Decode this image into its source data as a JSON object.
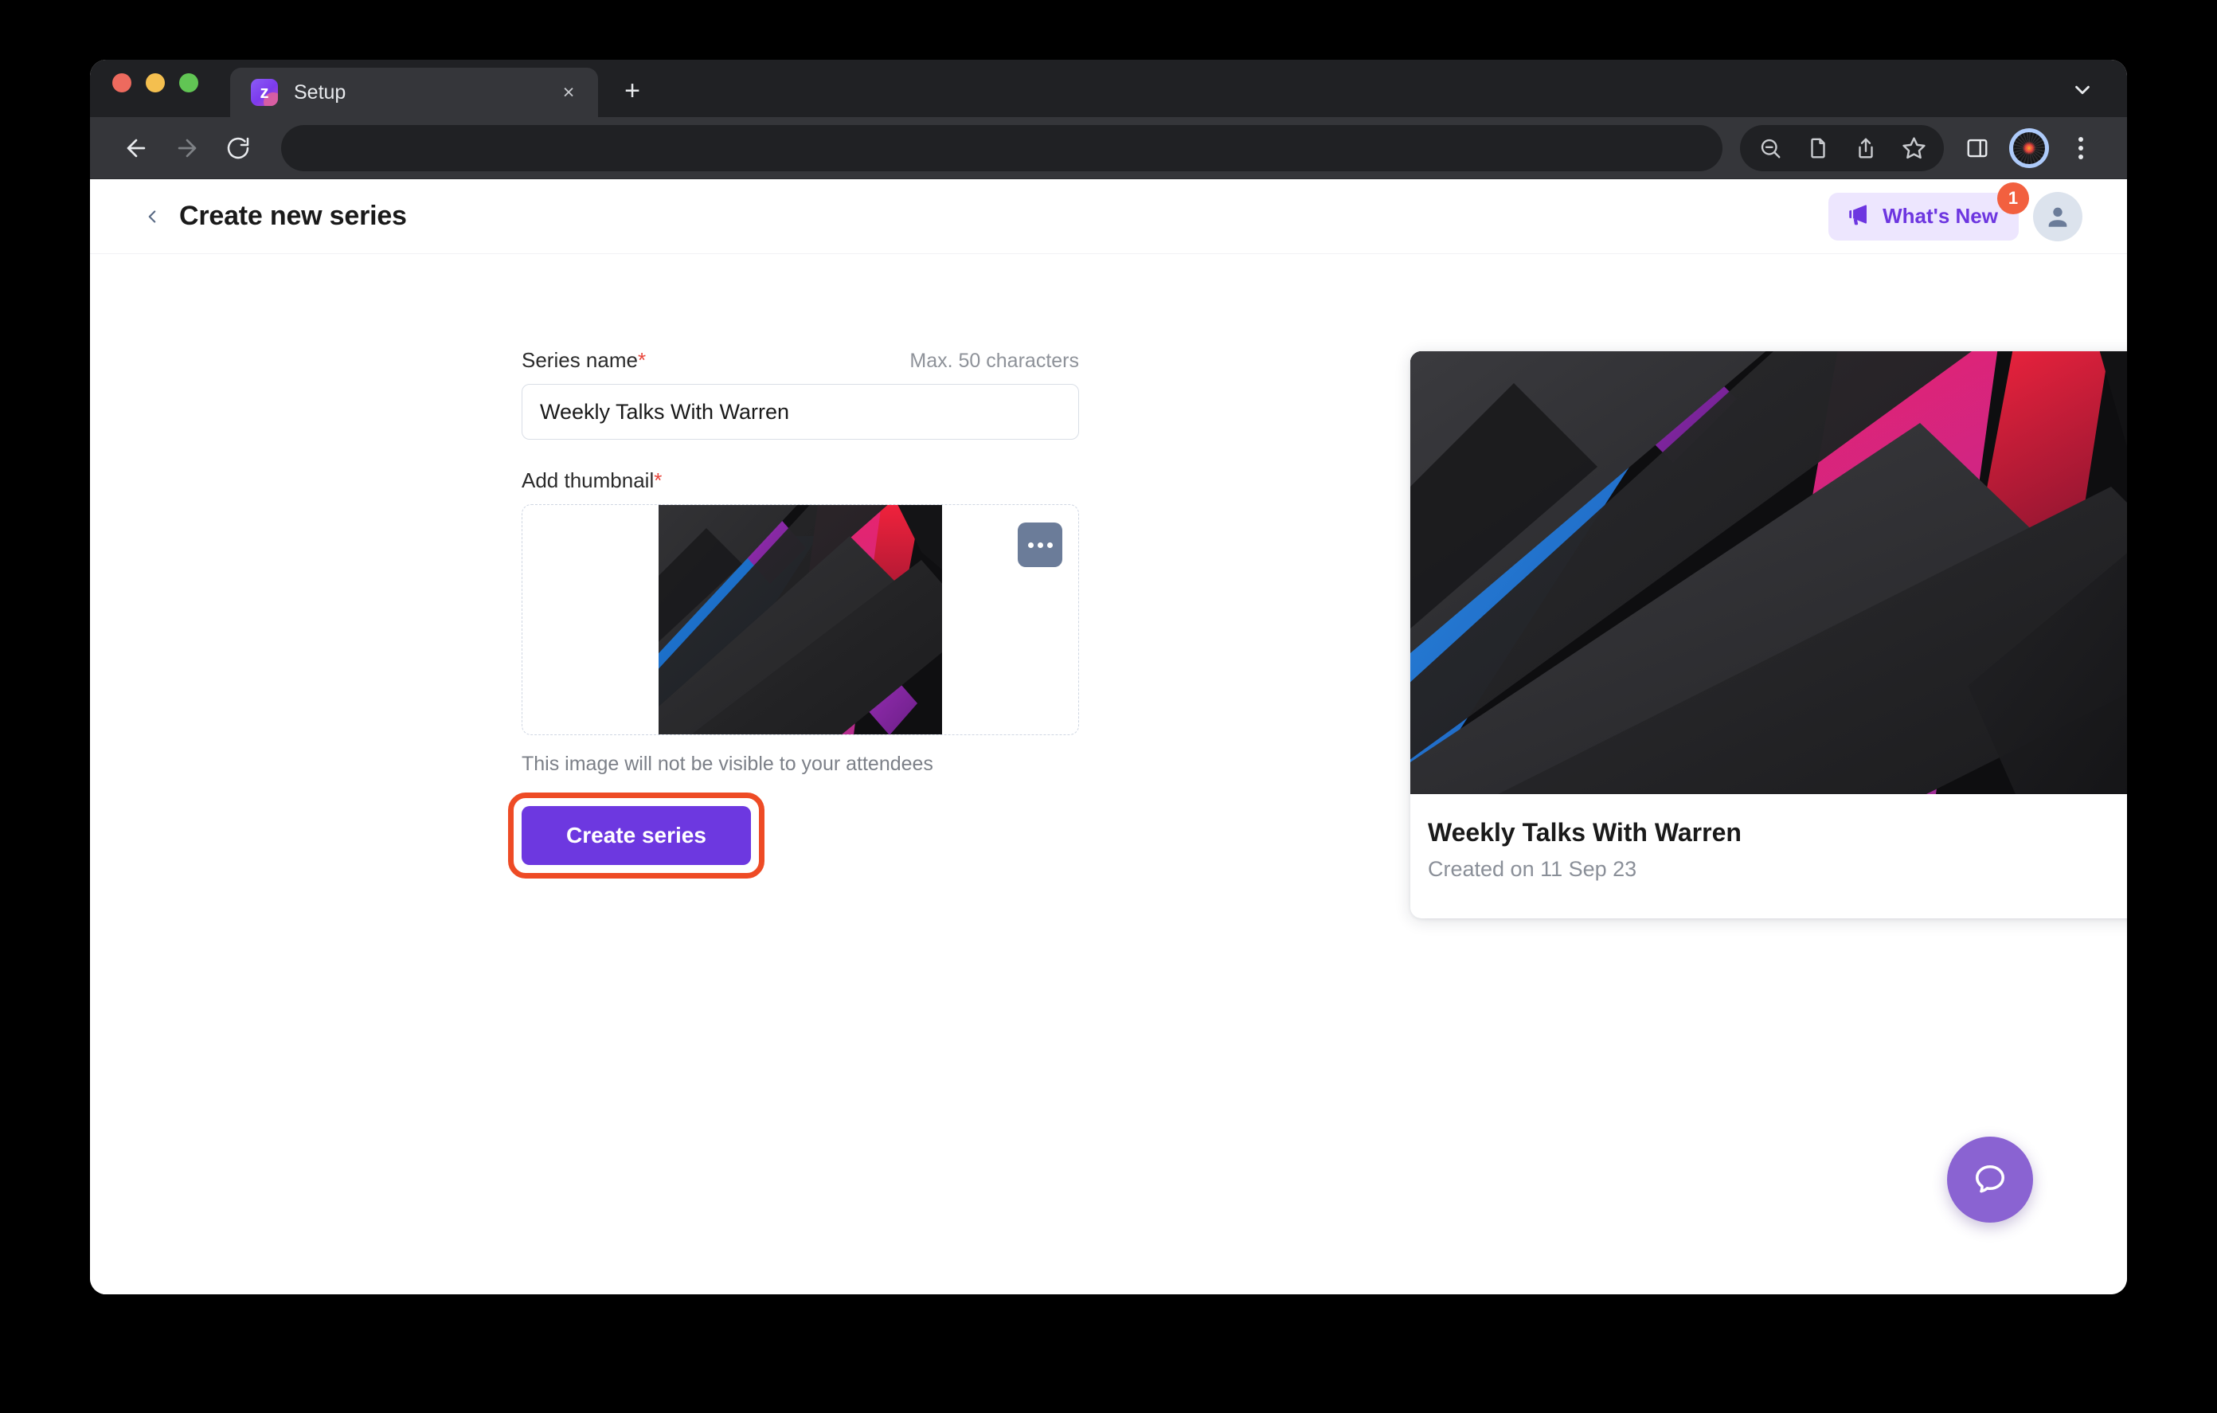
{
  "browser": {
    "tab": {
      "title": "Setup",
      "favicon_letter": "z"
    },
    "address_bar": {
      "value": "",
      "placeholder": ""
    },
    "toolbar_icons": [
      "zoom-out-icon",
      "reader-page-icon",
      "share-icon",
      "bookmark-star-icon",
      "side-panel-icon",
      "profile-avatar-icon",
      "kebab-menu-icon"
    ],
    "nav_icons": [
      "back-arrow-icon",
      "forward-arrow-icon",
      "reload-icon"
    ],
    "tab_list_icon": "chevron-down-icon",
    "new_tab_label": "+",
    "close_tab_label": "×"
  },
  "header": {
    "back_icon": "chevron-left-icon",
    "title": "Create new series",
    "whats_new": {
      "label": "What's New",
      "icon": "megaphone-icon",
      "badge": "1",
      "text_color": "#6D36E0",
      "background": "#EDE6FE",
      "badge_color": "#F2603F"
    },
    "avatar_icon": "person-icon"
  },
  "form": {
    "series_name": {
      "label": "Series name",
      "required_marker": "*",
      "max_hint": "Max. 50 characters",
      "value": "Weekly Talks With Warren",
      "placeholder": "Enter series name"
    },
    "thumbnail": {
      "label": "Add thumbnail",
      "required_marker": "*",
      "more_icon": "ellipsis-icon",
      "helper_text": "This image will not be visible to your attendees"
    },
    "submit": {
      "label": "Create series",
      "color": "#6D38E0",
      "highlight_ring_color": "#EE4B25"
    }
  },
  "preview": {
    "title": "Weekly Talks With Warren",
    "subtitle": "Created on 11 Sep 23"
  },
  "help_fab": {
    "icon": "chat-bubble-icon",
    "color": "#8A63D2"
  }
}
